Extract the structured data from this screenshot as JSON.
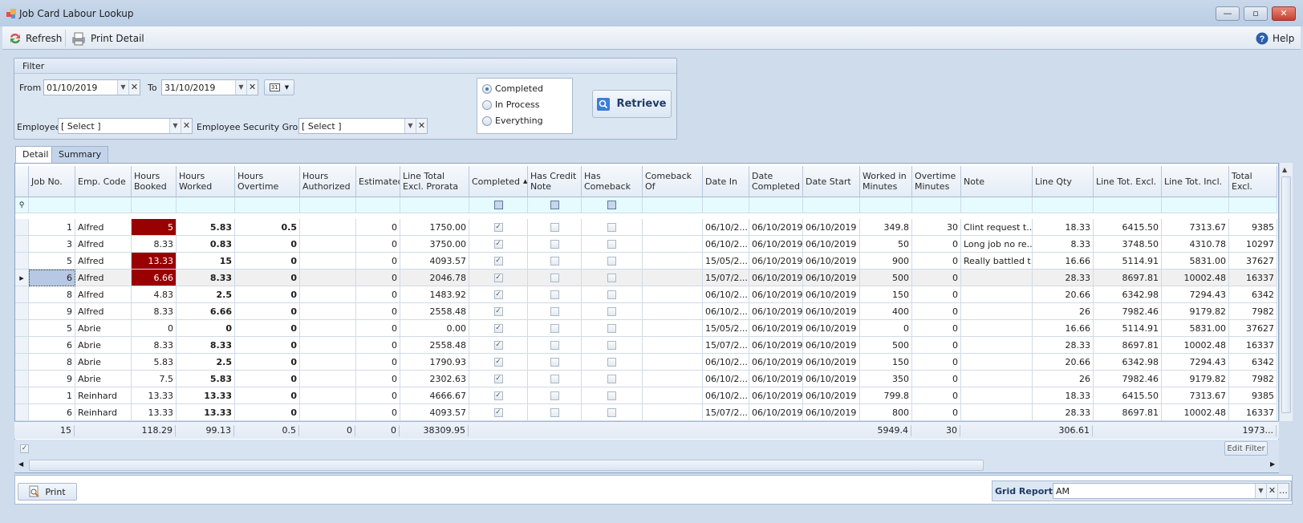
{
  "window": {
    "title": "Job Card Labour Lookup",
    "minimize": "—",
    "maximize": "▫",
    "close": "✕"
  },
  "toolbar": {
    "refresh": "Refresh",
    "print_detail": "Print Detail",
    "help": "Help"
  },
  "filter": {
    "title": "Filter",
    "from_label": "From",
    "from_value": "01/10/2019",
    "to_label": "To",
    "to_value": "31/10/2019",
    "calendar_label": "31",
    "employee_label": "Employee",
    "employee_value": "[ Select ]",
    "group_label": "Employee Security Group",
    "group_value": "[ Select ]",
    "status_options": [
      {
        "label": "Completed",
        "selected": true
      },
      {
        "label": "In Process",
        "selected": false
      },
      {
        "label": "Everything",
        "selected": false
      }
    ],
    "retrieve": "Retrieve"
  },
  "tabs": [
    {
      "label": "Detail",
      "active": true
    },
    {
      "label": "Summary",
      "active": false
    }
  ],
  "grid": {
    "columns": [
      {
        "key": "job",
        "label": "Job No.",
        "align": "num"
      },
      {
        "key": "emp",
        "label": "Emp. Code"
      },
      {
        "key": "hb",
        "label": "Hours Booked",
        "align": "num"
      },
      {
        "key": "hw",
        "label": "Hours Worked",
        "align": "num",
        "bold": true
      },
      {
        "key": "ho",
        "label": "Hours Overtime",
        "align": "num",
        "bold": true
      },
      {
        "key": "ha",
        "label": "Hours Authorized",
        "align": "num"
      },
      {
        "key": "est",
        "label": "Estimated",
        "align": "num"
      },
      {
        "key": "ltp",
        "label": "Line Total Excl. Prorata",
        "align": "num"
      },
      {
        "key": "comp",
        "label": "Completed",
        "type": "check",
        "sorted": "asc"
      },
      {
        "key": "credit",
        "label": "Has Credit Note",
        "type": "check"
      },
      {
        "key": "comeback",
        "label": "Has Comeback",
        "type": "check"
      },
      {
        "key": "cbof",
        "label": "Comeback Of"
      },
      {
        "key": "din",
        "label": "Date In"
      },
      {
        "key": "dcomp",
        "label": "Date Completed"
      },
      {
        "key": "dstart",
        "label": "Date Start"
      },
      {
        "key": "wim",
        "label": "Worked in Minutes",
        "align": "num"
      },
      {
        "key": "om",
        "label": "Overtime Minutes",
        "align": "num"
      },
      {
        "key": "note",
        "label": "Note"
      },
      {
        "key": "lqty",
        "label": "Line Qty",
        "align": "num"
      },
      {
        "key": "lte",
        "label": "Line Tot. Excl.",
        "align": "num"
      },
      {
        "key": "lti",
        "label": "Line Tot. Incl.",
        "align": "num"
      },
      {
        "key": "te",
        "label": "Total Excl.",
        "align": "num"
      }
    ],
    "highlight_color": "#990000",
    "rows": [
      {
        "job": "1",
        "emp": "Alfred",
        "hb": "5",
        "hb_flag": true,
        "hw": "5.83",
        "ho": "0.5",
        "ha": "",
        "est": "0",
        "ltp": "1750.00",
        "comp": true,
        "credit": false,
        "comeback": false,
        "cbof": "",
        "din": "06/10/2...",
        "dcomp": "06/10/2019",
        "dstart": "06/10/2019",
        "wim": "349.8",
        "om": "30",
        "note": "Clint request t...",
        "lqty": "18.33",
        "lte": "6415.50",
        "lti": "7313.67",
        "te": "9385"
      },
      {
        "job": "3",
        "emp": "Alfred",
        "hb": "8.33",
        "hw": "0.83",
        "ho": "0",
        "ha": "",
        "est": "0",
        "ltp": "3750.00",
        "comp": true,
        "credit": false,
        "comeback": false,
        "cbof": "",
        "din": "06/10/2...",
        "dcomp": "06/10/2019",
        "dstart": "06/10/2019",
        "wim": "50",
        "om": "0",
        "note": "Long job no re...",
        "lqty": "8.33",
        "lte": "3748.50",
        "lti": "4310.78",
        "te": "10297"
      },
      {
        "job": "5",
        "emp": "Alfred",
        "hb": "13.33",
        "hb_flag": true,
        "hw": "15",
        "ho": "0",
        "ha": "",
        "est": "0",
        "ltp": "4093.57",
        "comp": true,
        "credit": false,
        "comeback": false,
        "cbof": "",
        "din": "15/05/2...",
        "dcomp": "06/10/2019",
        "dstart": "06/10/2019",
        "wim": "900",
        "om": "0",
        "note": "Really battled t...",
        "lqty": "16.66",
        "lte": "5114.91",
        "lti": "5831.00",
        "te": "37627"
      },
      {
        "job": "6",
        "emp": "Alfred",
        "hb": "6.66",
        "hb_flag": true,
        "selected": true,
        "hw": "8.33",
        "ho": "0",
        "ha": "",
        "est": "0",
        "ltp": "2046.78",
        "comp": true,
        "credit": false,
        "comeback": false,
        "cbof": "",
        "din": "15/07/2...",
        "dcomp": "06/10/2019",
        "dstart": "06/10/2019",
        "wim": "500",
        "om": "0",
        "note": "",
        "lqty": "28.33",
        "lte": "8697.81",
        "lti": "10002.48",
        "te": "16337"
      },
      {
        "job": "8",
        "emp": "Alfred",
        "hb": "4.83",
        "hw": "2.5",
        "ho": "0",
        "ha": "",
        "est": "0",
        "ltp": "1483.92",
        "comp": true,
        "credit": false,
        "comeback": false,
        "cbof": "",
        "din": "06/10/2...",
        "dcomp": "06/10/2019",
        "dstart": "06/10/2019",
        "wim": "150",
        "om": "0",
        "note": "",
        "lqty": "20.66",
        "lte": "6342.98",
        "lti": "7294.43",
        "te": "6342"
      },
      {
        "job": "9",
        "emp": "Alfred",
        "hb": "8.33",
        "hw": "6.66",
        "ho": "0",
        "ha": "",
        "est": "0",
        "ltp": "2558.48",
        "comp": true,
        "credit": false,
        "comeback": false,
        "cbof": "",
        "din": "06/10/2...",
        "dcomp": "06/10/2019",
        "dstart": "06/10/2019",
        "wim": "400",
        "om": "0",
        "note": "",
        "lqty": "26",
        "lte": "7982.46",
        "lti": "9179.82",
        "te": "7982"
      },
      {
        "job": "5",
        "emp": "Abrie",
        "hb": "0",
        "hw": "0",
        "ho": "0",
        "ha": "",
        "est": "0",
        "ltp": "0.00",
        "comp": true,
        "credit": false,
        "comeback": false,
        "cbof": "",
        "din": "15/05/2...",
        "dcomp": "06/10/2019",
        "dstart": "06/10/2019",
        "wim": "0",
        "om": "0",
        "note": "",
        "lqty": "16.66",
        "lte": "5114.91",
        "lti": "5831.00",
        "te": "37627"
      },
      {
        "job": "6",
        "emp": "Abrie",
        "hb": "8.33",
        "hw": "8.33",
        "ho": "0",
        "ha": "",
        "est": "0",
        "ltp": "2558.48",
        "comp": true,
        "credit": false,
        "comeback": false,
        "cbof": "",
        "din": "15/07/2...",
        "dcomp": "06/10/2019",
        "dstart": "06/10/2019",
        "wim": "500",
        "om": "0",
        "note": "",
        "lqty": "28.33",
        "lte": "8697.81",
        "lti": "10002.48",
        "te": "16337"
      },
      {
        "job": "8",
        "emp": "Abrie",
        "hb": "5.83",
        "hw": "2.5",
        "ho": "0",
        "ha": "",
        "est": "0",
        "ltp": "1790.93",
        "comp": true,
        "credit": false,
        "comeback": false,
        "cbof": "",
        "din": "06/10/2...",
        "dcomp": "06/10/2019",
        "dstart": "06/10/2019",
        "wim": "150",
        "om": "0",
        "note": "",
        "lqty": "20.66",
        "lte": "6342.98",
        "lti": "7294.43",
        "te": "6342"
      },
      {
        "job": "9",
        "emp": "Abrie",
        "hb": "7.5",
        "hw": "5.83",
        "ho": "0",
        "ha": "",
        "est": "0",
        "ltp": "2302.63",
        "comp": true,
        "credit": false,
        "comeback": false,
        "cbof": "",
        "din": "06/10/2...",
        "dcomp": "06/10/2019",
        "dstart": "06/10/2019",
        "wim": "350",
        "om": "0",
        "note": "",
        "lqty": "26",
        "lte": "7982.46",
        "lti": "9179.82",
        "te": "7982"
      },
      {
        "job": "1",
        "emp": "Reinhard",
        "hb": "13.33",
        "hw": "13.33",
        "ho": "0",
        "ha": "",
        "est": "0",
        "ltp": "4666.67",
        "comp": true,
        "credit": false,
        "comeback": false,
        "cbof": "",
        "din": "06/10/2...",
        "dcomp": "06/10/2019",
        "dstart": "06/10/2019",
        "wim": "799.8",
        "om": "0",
        "note": "",
        "lqty": "18.33",
        "lte": "6415.50",
        "lti": "7313.67",
        "te": "9385"
      },
      {
        "job": "6",
        "emp": "Reinhard",
        "hb": "13.33",
        "hw": "13.33",
        "ho": "0",
        "ha": "",
        "est": "0",
        "ltp": "4093.57",
        "comp": true,
        "credit": false,
        "comeback": false,
        "cbof": "",
        "din": "15/07/2...",
        "dcomp": "06/10/2019",
        "dstart": "06/10/2019",
        "wim": "800",
        "om": "0",
        "note": "",
        "lqty": "28.33",
        "lte": "8697.81",
        "lti": "10002.48",
        "te": "16337"
      }
    ],
    "totals": {
      "job": "15",
      "hb": "118.29",
      "hw": "99.13",
      "ho": "0.5",
      "ha": "0",
      "est": "0",
      "ltp": "38309.95",
      "wim": "5949.4",
      "om": "30",
      "lqty": "306.61",
      "te": "1973..."
    },
    "edit_filter": "Edit Filter"
  },
  "footer": {
    "print": "Print",
    "grid_report_label": "Grid Report:",
    "grid_report_value": "AM"
  }
}
